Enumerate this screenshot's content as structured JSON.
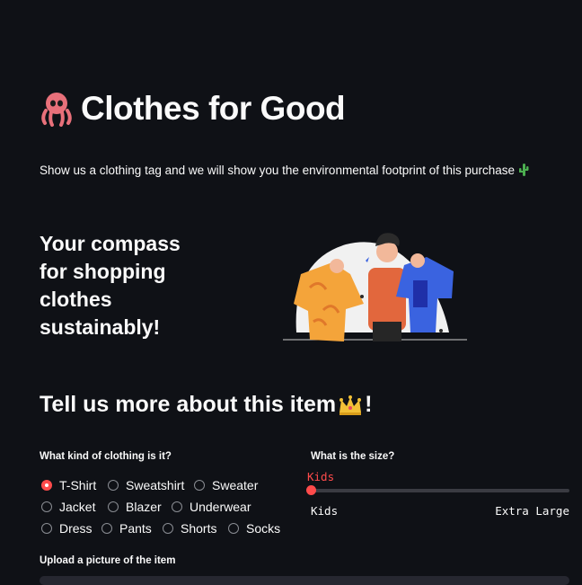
{
  "header": {
    "title": "Clothes for Good",
    "subtitle": "Show us a clothing tag and we will show you the environmental footprint of this purchase",
    "tagline": "Your compass for shopping clothes sustainably!"
  },
  "form": {
    "section_title": "Tell us more about this item",
    "kind_label": "What kind of clothing is it?",
    "kind_options": [
      "T-Shirt",
      "Sweatshirt",
      "Sweater",
      "Jacket",
      "Blazer",
      "Underwear",
      "Dress",
      "Pants",
      "Shorts",
      "Socks"
    ],
    "kind_selected": "T-Shirt",
    "size_label": "What is the size?",
    "size_value": "Kids",
    "size_min_label": "Kids",
    "size_max_label": "Extra Large",
    "upload_label": "Upload a picture of the item"
  },
  "colors": {
    "background": "#0f1116",
    "accent": "#ff4b4b",
    "text": "#fafafa"
  },
  "icons": {
    "title": "octopus-icon",
    "subtitle": "cactus-icon",
    "section": "crown-icon"
  }
}
